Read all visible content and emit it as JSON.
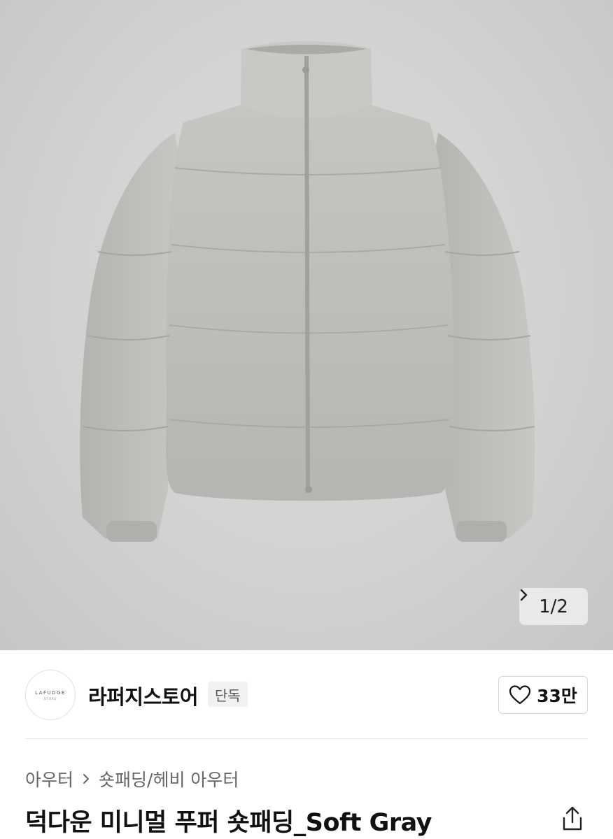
{
  "gallery": {
    "current": "1",
    "total": "2",
    "pager_text": "1/2",
    "image_desc": "puffer-jacket-photo"
  },
  "store": {
    "logo_text": "LAFUDGE",
    "logo_subtext": "STORE",
    "name": "라퍼지스토어",
    "badge": "단독",
    "like_count": "33만"
  },
  "breadcrumb": {
    "items": [
      "아우터",
      "숏패딩/헤비 아우터"
    ]
  },
  "product": {
    "title": "덕다운 미니멀 푸퍼 숏패딩_Soft Gray"
  },
  "icons": {
    "pager_next": "chevron-right-icon",
    "like": "heart-icon",
    "breadcrumb_sep": "chevron-right-icon",
    "share": "share-icon"
  },
  "colors": {
    "jacket": "#bfc1bd",
    "background": "#d4d4d4"
  }
}
